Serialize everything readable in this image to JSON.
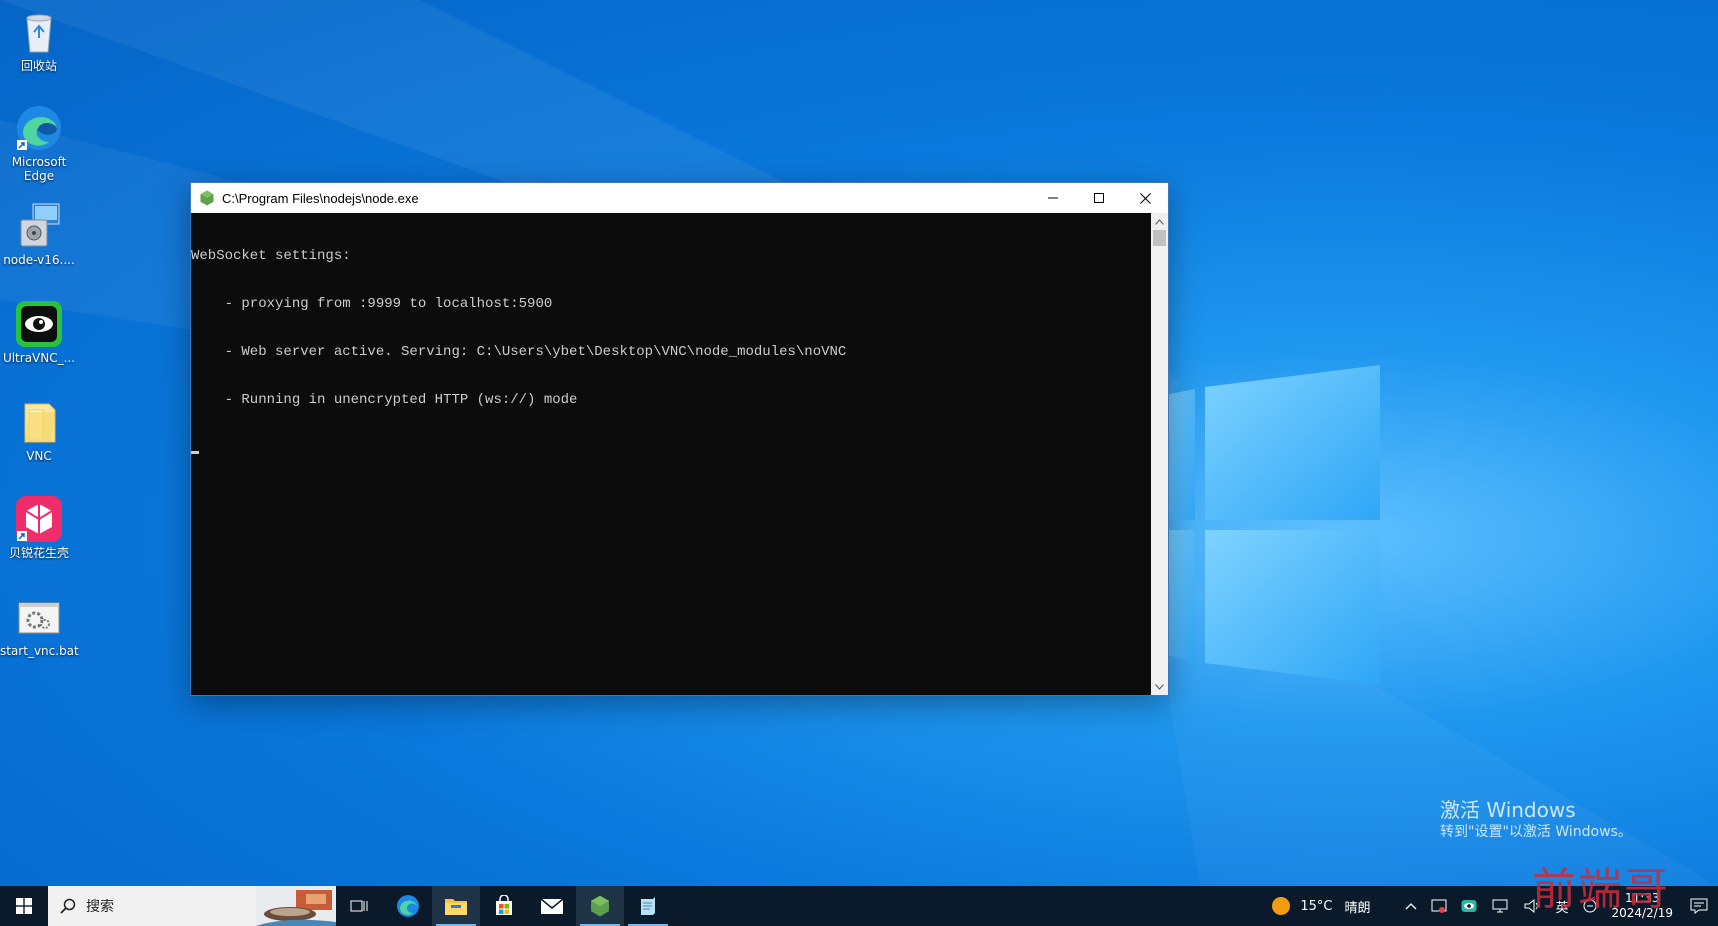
{
  "desktop": {
    "icons": [
      {
        "label": "回收站",
        "icon": "recycle-bin-icon"
      },
      {
        "label": "Microsoft Edge",
        "icon": "edge-icon"
      },
      {
        "label": "node-v16....",
        "icon": "installer-icon"
      },
      {
        "label": "UltraVNC_...",
        "icon": "ultravnc-icon"
      },
      {
        "label": "VNC",
        "icon": "folder-icon"
      },
      {
        "label": "贝锐花生壳",
        "icon": "oray-peanut-icon"
      },
      {
        "label": "start_vnc.bat",
        "icon": "batch-file-icon"
      }
    ]
  },
  "window": {
    "title": "C:\\Program Files\\nodejs\\node.exe",
    "console_lines": [
      "WebSocket settings:",
      "    - proxying from :9999 to localhost:5900",
      "    - Web server active. Serving: C:\\Users\\ybet\\Desktop\\VNC\\node_modules\\noVNC",
      "    - Running in unencrypted HTTP (ws://) mode"
    ]
  },
  "watermark": {
    "activate_title": "激活 Windows",
    "activate_sub": "转到\"设置\"以激活 Windows。",
    "brand": "前端哥"
  },
  "taskbar": {
    "search_placeholder": "搜索",
    "pinned": [
      "task-view-icon",
      "edge-icon",
      "file-explorer-icon",
      "store-icon",
      "mail-icon",
      "nodejs-icon",
      "notepad-icon"
    ],
    "weather_temp": "15°C",
    "weather_desc": "晴朗",
    "ime": "英",
    "time": "11:33",
    "date": "2024/2/19"
  },
  "colors": {
    "accent": "#0a78dc",
    "taskbar": "#0a1a2b",
    "console_bg": "#0c0c0c",
    "console_fg": "#cccccc"
  }
}
